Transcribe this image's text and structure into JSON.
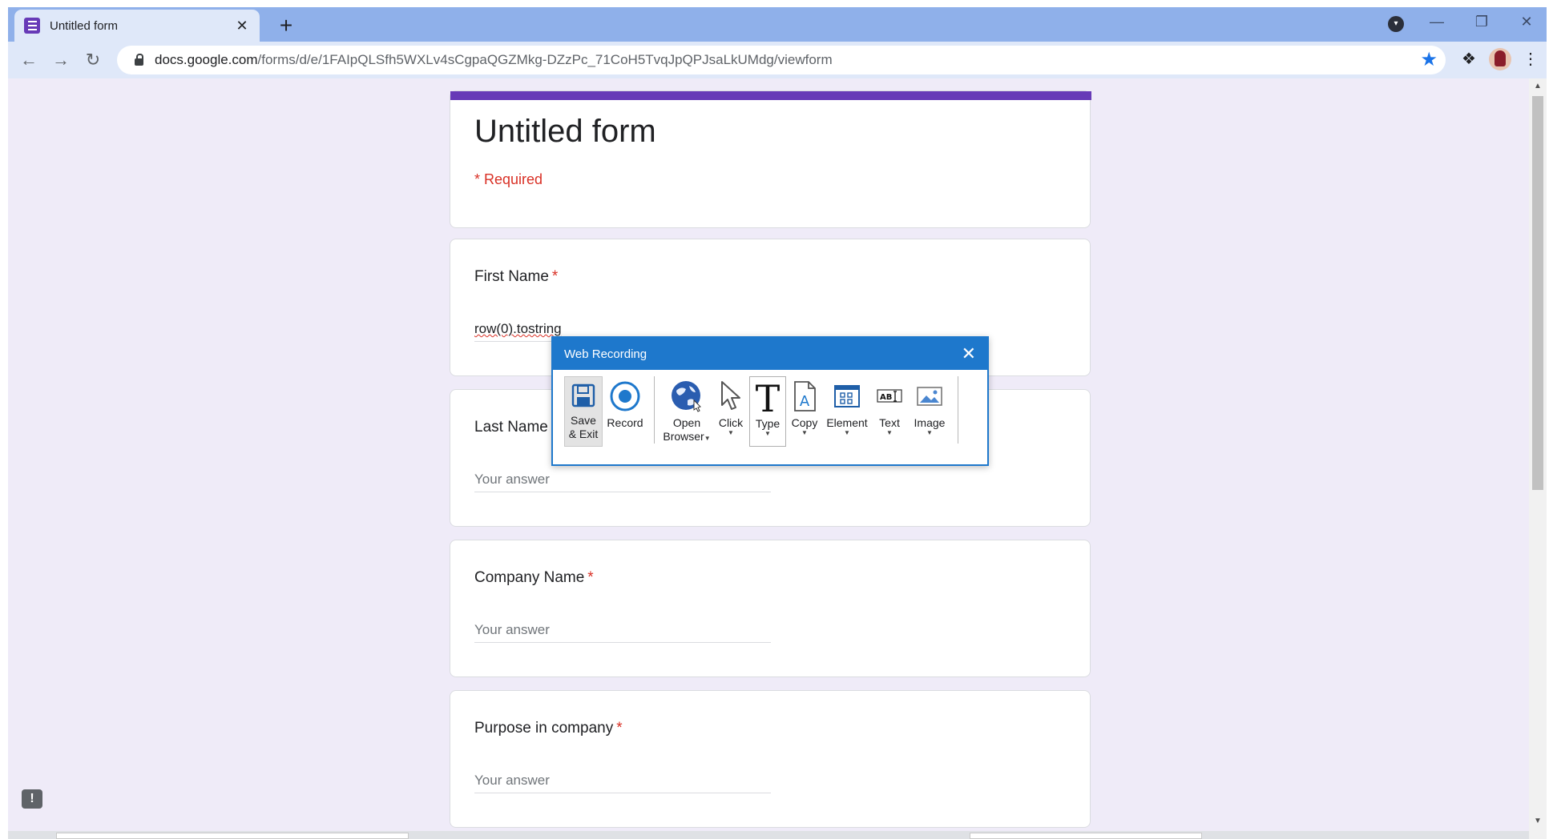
{
  "browser": {
    "tab_title": "Untitled form",
    "tab_close": "✕",
    "new_tab": "+",
    "url_host": "docs.google.com",
    "url_path": "/forms/d/e/1FAIpQLSfh5WXLv4sCgpaQGZMkg-DZzPc_71CoH5TvqJpQPJsaLkUMdg/viewform",
    "win_minimize": "—",
    "win_restore": "❐",
    "win_close": "✕",
    "profile_dropdown": "▾"
  },
  "form": {
    "title": "Untitled form",
    "required_note": "* Required",
    "questions": [
      {
        "label": "First Name",
        "required_mark": "*",
        "answer": "row(0).tostring"
      },
      {
        "label": "Last Name",
        "required_mark": "*",
        "answer": "Your answer"
      },
      {
        "label": "Company Name",
        "required_mark": "*",
        "answer": "Your answer"
      },
      {
        "label": "Purpose in company",
        "required_mark": "*",
        "answer": "Your answer"
      }
    ]
  },
  "recorder": {
    "title": "Web Recording",
    "close": "✕",
    "buttons": {
      "save_exit_1": "Save",
      "save_exit_2": "& Exit",
      "record": "Record",
      "open_browser_1": "Open",
      "open_browser_2": "Browser",
      "click": "Click",
      "type": "Type",
      "copy": "Copy",
      "element": "Element",
      "text": "Text",
      "image": "Image"
    }
  },
  "colors": {
    "accent": "#673ab7",
    "required": "#d93025",
    "recorder_blue": "#1e78cc",
    "page_bg": "#efebf8"
  }
}
